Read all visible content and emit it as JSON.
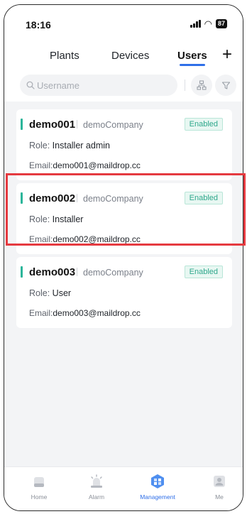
{
  "status_bar": {
    "time": "18:16",
    "battery": "87"
  },
  "tabs": [
    {
      "label": "Plants",
      "active": false
    },
    {
      "label": "Devices",
      "active": false
    },
    {
      "label": "Users",
      "active": true
    }
  ],
  "add_button": "+",
  "search": {
    "placeholder": "Username"
  },
  "users": [
    {
      "username": "demo001",
      "company": "demoCompany",
      "status": "Enabled",
      "role_label": "Role:",
      "role": "Installer admin",
      "email_label": "Email:",
      "email": "demo001@maildrop.cc"
    },
    {
      "username": "demo002",
      "company": "demoCompany",
      "status": "Enabled",
      "role_label": "Role:",
      "role": "Installer",
      "email_label": "Email:",
      "email": "demo002@maildrop.cc"
    },
    {
      "username": "demo003",
      "company": "demoCompany",
      "status": "Enabled",
      "role_label": "Role:",
      "role": "User",
      "email_label": "Email:",
      "email": "demo003@maildrop.cc"
    }
  ],
  "bottom_nav": [
    {
      "label": "Home",
      "icon": "home-icon"
    },
    {
      "label": "Alarm",
      "icon": "alarm-icon"
    },
    {
      "label": "Management",
      "icon": "management-icon",
      "active": true
    },
    {
      "label": "Me",
      "icon": "me-icon"
    }
  ],
  "colors": {
    "accent_blue": "#2f6fe8",
    "status_green": "#2fa88c",
    "highlight_red": "#e53a40"
  }
}
